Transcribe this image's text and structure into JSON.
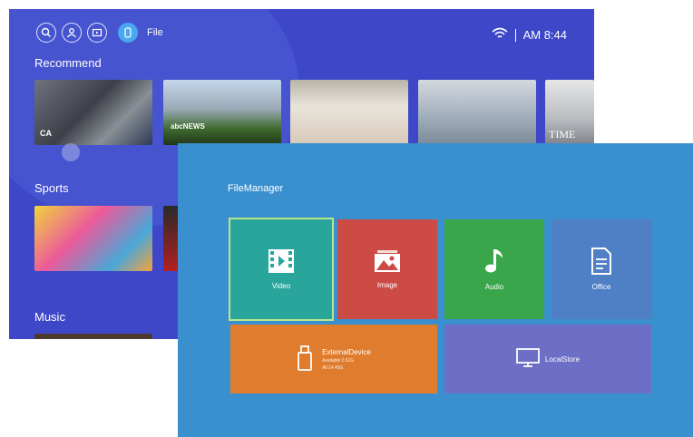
{
  "topbar": {
    "file_label": "File",
    "time": "AM 8:44",
    "icons": [
      "search-icon",
      "user-icon",
      "tv-input-icon",
      "file-icon",
      "wifi-icon"
    ]
  },
  "sections": {
    "recommend": "Recommend",
    "sports": "Sports",
    "music": "Music"
  },
  "thumbs": {
    "t1_caption": "CA",
    "t2_caption": "abcNEWS",
    "t5_caption": "TIME"
  },
  "file_manager": {
    "title": "FileManager",
    "tiles": {
      "video": "Video",
      "image": "Image",
      "audio": "Audio",
      "office": "Office",
      "external_device": "ExternalDevice",
      "external_sub1": "Available:2.61G",
      "external_sub2": "All:14.45G",
      "local_store": "LocalStore"
    }
  },
  "colors": {
    "back_bg": "#3e47c8",
    "front_bg": "#3a90cf",
    "video": "#2aa59b",
    "image": "#cd4b45",
    "audio": "#39a64b",
    "office": "#4f7fc4",
    "external": "#e07c2e",
    "local": "#6d6fc6"
  }
}
